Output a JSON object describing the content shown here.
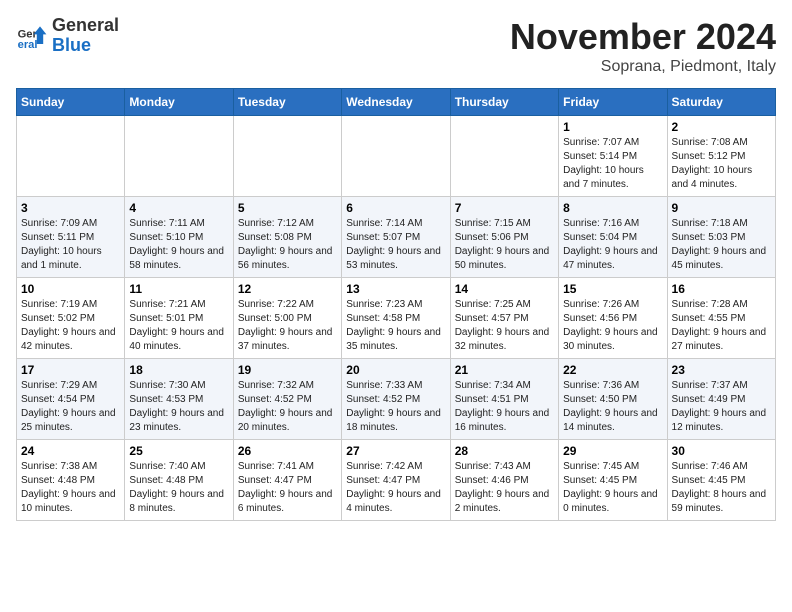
{
  "header": {
    "logo_general": "General",
    "logo_blue": "Blue",
    "month_title": "November 2024",
    "location": "Soprana, Piedmont, Italy"
  },
  "weekdays": [
    "Sunday",
    "Monday",
    "Tuesday",
    "Wednesday",
    "Thursday",
    "Friday",
    "Saturday"
  ],
  "weeks": [
    [
      {
        "day": "",
        "info": ""
      },
      {
        "day": "",
        "info": ""
      },
      {
        "day": "",
        "info": ""
      },
      {
        "day": "",
        "info": ""
      },
      {
        "day": "",
        "info": ""
      },
      {
        "day": "1",
        "info": "Sunrise: 7:07 AM\nSunset: 5:14 PM\nDaylight: 10 hours and 7 minutes."
      },
      {
        "day": "2",
        "info": "Sunrise: 7:08 AM\nSunset: 5:12 PM\nDaylight: 10 hours and 4 minutes."
      }
    ],
    [
      {
        "day": "3",
        "info": "Sunrise: 7:09 AM\nSunset: 5:11 PM\nDaylight: 10 hours and 1 minute."
      },
      {
        "day": "4",
        "info": "Sunrise: 7:11 AM\nSunset: 5:10 PM\nDaylight: 9 hours and 58 minutes."
      },
      {
        "day": "5",
        "info": "Sunrise: 7:12 AM\nSunset: 5:08 PM\nDaylight: 9 hours and 56 minutes."
      },
      {
        "day": "6",
        "info": "Sunrise: 7:14 AM\nSunset: 5:07 PM\nDaylight: 9 hours and 53 minutes."
      },
      {
        "day": "7",
        "info": "Sunrise: 7:15 AM\nSunset: 5:06 PM\nDaylight: 9 hours and 50 minutes."
      },
      {
        "day": "8",
        "info": "Sunrise: 7:16 AM\nSunset: 5:04 PM\nDaylight: 9 hours and 47 minutes."
      },
      {
        "day": "9",
        "info": "Sunrise: 7:18 AM\nSunset: 5:03 PM\nDaylight: 9 hours and 45 minutes."
      }
    ],
    [
      {
        "day": "10",
        "info": "Sunrise: 7:19 AM\nSunset: 5:02 PM\nDaylight: 9 hours and 42 minutes."
      },
      {
        "day": "11",
        "info": "Sunrise: 7:21 AM\nSunset: 5:01 PM\nDaylight: 9 hours and 40 minutes."
      },
      {
        "day": "12",
        "info": "Sunrise: 7:22 AM\nSunset: 5:00 PM\nDaylight: 9 hours and 37 minutes."
      },
      {
        "day": "13",
        "info": "Sunrise: 7:23 AM\nSunset: 4:58 PM\nDaylight: 9 hours and 35 minutes."
      },
      {
        "day": "14",
        "info": "Sunrise: 7:25 AM\nSunset: 4:57 PM\nDaylight: 9 hours and 32 minutes."
      },
      {
        "day": "15",
        "info": "Sunrise: 7:26 AM\nSunset: 4:56 PM\nDaylight: 9 hours and 30 minutes."
      },
      {
        "day": "16",
        "info": "Sunrise: 7:28 AM\nSunset: 4:55 PM\nDaylight: 9 hours and 27 minutes."
      }
    ],
    [
      {
        "day": "17",
        "info": "Sunrise: 7:29 AM\nSunset: 4:54 PM\nDaylight: 9 hours and 25 minutes."
      },
      {
        "day": "18",
        "info": "Sunrise: 7:30 AM\nSunset: 4:53 PM\nDaylight: 9 hours and 23 minutes."
      },
      {
        "day": "19",
        "info": "Sunrise: 7:32 AM\nSunset: 4:52 PM\nDaylight: 9 hours and 20 minutes."
      },
      {
        "day": "20",
        "info": "Sunrise: 7:33 AM\nSunset: 4:52 PM\nDaylight: 9 hours and 18 minutes."
      },
      {
        "day": "21",
        "info": "Sunrise: 7:34 AM\nSunset: 4:51 PM\nDaylight: 9 hours and 16 minutes."
      },
      {
        "day": "22",
        "info": "Sunrise: 7:36 AM\nSunset: 4:50 PM\nDaylight: 9 hours and 14 minutes."
      },
      {
        "day": "23",
        "info": "Sunrise: 7:37 AM\nSunset: 4:49 PM\nDaylight: 9 hours and 12 minutes."
      }
    ],
    [
      {
        "day": "24",
        "info": "Sunrise: 7:38 AM\nSunset: 4:48 PM\nDaylight: 9 hours and 10 minutes."
      },
      {
        "day": "25",
        "info": "Sunrise: 7:40 AM\nSunset: 4:48 PM\nDaylight: 9 hours and 8 minutes."
      },
      {
        "day": "26",
        "info": "Sunrise: 7:41 AM\nSunset: 4:47 PM\nDaylight: 9 hours and 6 minutes."
      },
      {
        "day": "27",
        "info": "Sunrise: 7:42 AM\nSunset: 4:47 PM\nDaylight: 9 hours and 4 minutes."
      },
      {
        "day": "28",
        "info": "Sunrise: 7:43 AM\nSunset: 4:46 PM\nDaylight: 9 hours and 2 minutes."
      },
      {
        "day": "29",
        "info": "Sunrise: 7:45 AM\nSunset: 4:45 PM\nDaylight: 9 hours and 0 minutes."
      },
      {
        "day": "30",
        "info": "Sunrise: 7:46 AM\nSunset: 4:45 PM\nDaylight: 8 hours and 59 minutes."
      }
    ]
  ]
}
